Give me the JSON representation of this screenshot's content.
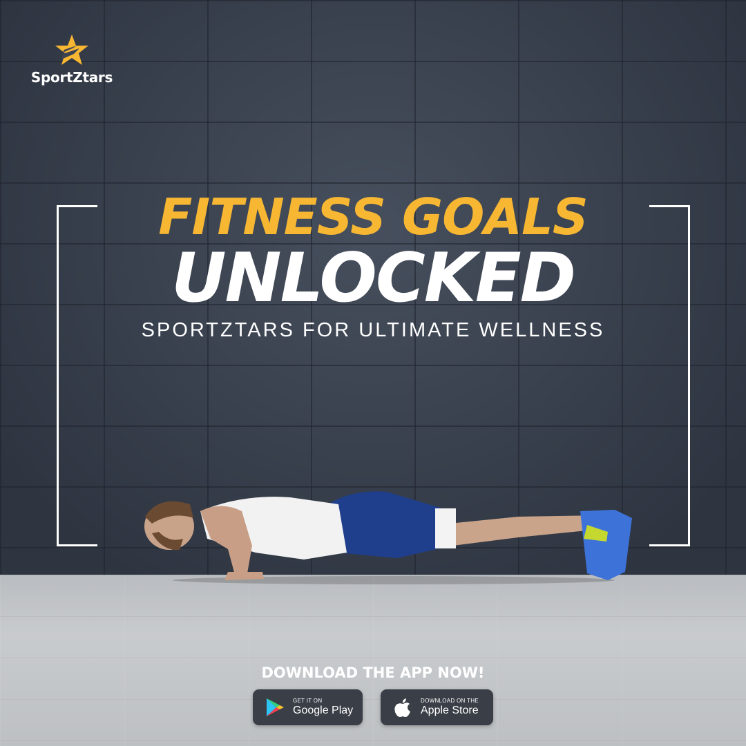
{
  "brand": {
    "name": "SportZtars",
    "colors": {
      "accent": "#f7b733",
      "text": "#ffffff",
      "button": "#3a3f47"
    }
  },
  "hero": {
    "line1": "FITNESS GOALS",
    "line2": "UNLOCKED",
    "tagline": "SPORTZTARS FOR ULTIMATE WELLNESS"
  },
  "cta": {
    "heading": "DOWNLOAD THE APP NOW!",
    "google": {
      "small": "GET IT ON",
      "big": "Google Play",
      "icon": "google-play-icon"
    },
    "apple": {
      "small": "DOWNLOAD ON THE",
      "big": "Apple Store",
      "icon": "apple-icon"
    }
  }
}
